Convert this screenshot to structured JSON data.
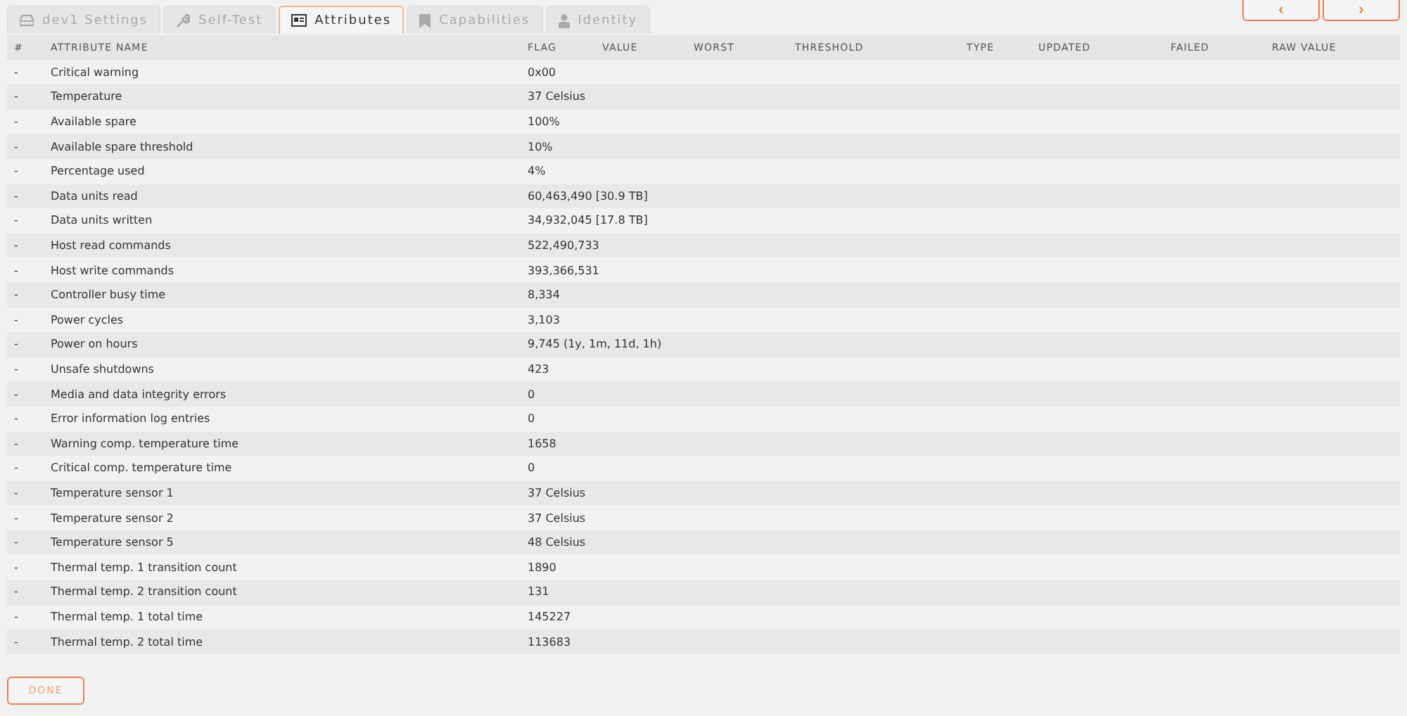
{
  "tabs": [
    {
      "label": "dev1 Settings",
      "selected": false
    },
    {
      "label": "Self-Test",
      "selected": false
    },
    {
      "label": "Attributes",
      "selected": true
    },
    {
      "label": "Capabilities",
      "selected": false
    },
    {
      "label": "Identity",
      "selected": false
    }
  ],
  "nav_buttons": [
    "‹",
    "›"
  ],
  "table": {
    "columns": [
      "#",
      "ATTRIBUTE NAME",
      "FLAG",
      "VALUE",
      "WORST",
      "THRESHOLD",
      "TYPE",
      "UPDATED",
      "FAILED",
      "RAW VALUE"
    ],
    "rows": [
      {
        "id": "-",
        "name": "Critical warning",
        "value": "0x00"
      },
      {
        "id": "-",
        "name": "Temperature",
        "value": "37 Celsius"
      },
      {
        "id": "-",
        "name": "Available spare",
        "value": "100%"
      },
      {
        "id": "-",
        "name": "Available spare threshold",
        "value": "10%"
      },
      {
        "id": "-",
        "name": "Percentage used",
        "value": "4%"
      },
      {
        "id": "-",
        "name": "Data units read",
        "value": "60,463,490 [30.9 TB]"
      },
      {
        "id": "-",
        "name": "Data units written",
        "value": "34,932,045 [17.8 TB]"
      },
      {
        "id": "-",
        "name": "Host read commands",
        "value": "522,490,733"
      },
      {
        "id": "-",
        "name": "Host write commands",
        "value": "393,366,531"
      },
      {
        "id": "-",
        "name": "Controller busy time",
        "value": "8,334"
      },
      {
        "id": "-",
        "name": "Power cycles",
        "value": "3,103"
      },
      {
        "id": "-",
        "name": "Power on hours",
        "value": "9,745 (1y, 1m, 11d, 1h)"
      },
      {
        "id": "-",
        "name": "Unsafe shutdowns",
        "value": "423"
      },
      {
        "id": "-",
        "name": "Media and data integrity errors",
        "value": "0"
      },
      {
        "id": "-",
        "name": "Error information log entries",
        "value": "0"
      },
      {
        "id": "-",
        "name": "Warning comp. temperature time",
        "value": "1658"
      },
      {
        "id": "-",
        "name": "Critical comp. temperature time",
        "value": "0"
      },
      {
        "id": "-",
        "name": "Temperature sensor 1",
        "value": "37 Celsius"
      },
      {
        "id": "-",
        "name": "Temperature sensor 2",
        "value": "37 Celsius"
      },
      {
        "id": "-",
        "name": "Temperature sensor 5",
        "value": "48 Celsius"
      },
      {
        "id": "-",
        "name": "Thermal temp. 1 transition count",
        "value": "1890"
      },
      {
        "id": "-",
        "name": "Thermal temp. 2 transition count",
        "value": "131"
      },
      {
        "id": "-",
        "name": "Thermal temp. 1 total time",
        "value": "145227"
      },
      {
        "id": "-",
        "name": "Thermal temp. 2 total time",
        "value": "113683"
      }
    ]
  },
  "done_button": "DONE"
}
